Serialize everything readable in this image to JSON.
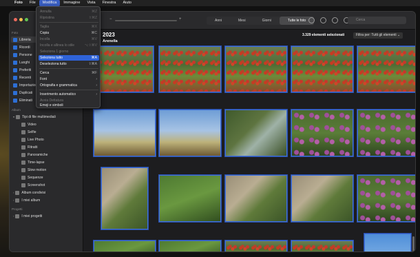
{
  "menubar": {
    "apple": "",
    "items": [
      "Foto",
      "File",
      "Modifica",
      "Immagine",
      "Vista",
      "Finestra",
      "Aiuto"
    ]
  },
  "sidebar": {
    "section_foto": "Foto",
    "items": [
      "Libreria",
      "Ricordi",
      "Persone",
      "Luoghi",
      "Preferiti",
      "Recenti",
      "Importazioni",
      "Duplicati",
      "Eliminati"
    ],
    "section_album": "Album",
    "media_types_label": "Tipi di file multimediali",
    "media_types": [
      "Video",
      "Selfie",
      "Live Photo",
      "Ritratti",
      "Panoramiche",
      "Time-lapse",
      "Slow motion",
      "Sequenze",
      "Screenshot"
    ],
    "shared_albums": "Album condivisi",
    "my_albums": "I miei album",
    "section_projects": "Progetti",
    "my_projects": "I miei progetti"
  },
  "toolbar": {
    "zoom_min": "−",
    "zoom_plus": "+",
    "views": [
      "Anni",
      "Mesi",
      "Giorni",
      "Tutte le foto"
    ],
    "active_view": "Tutte le foto",
    "search_placeholder": "Cerca"
  },
  "content": {
    "year": "2023",
    "location": "Arenella",
    "selection_count": "3.329 elementi selezionati",
    "filter": "Filtra per: Tutti gli elementi ⌄"
  },
  "edit_menu": {
    "items": [
      {
        "label": "Annulla",
        "shortcut": "⌘Z",
        "enabled": false
      },
      {
        "label": "Ripristina",
        "shortcut": "⇧⌘Z",
        "enabled": false
      },
      {
        "label": "Taglia",
        "shortcut": "⌘X",
        "enabled": false
      },
      {
        "label": "Copia",
        "shortcut": "⌘C",
        "enabled": true
      },
      {
        "label": "Incolla",
        "shortcut": "⌘V",
        "enabled": false
      },
      {
        "label": "Incolla e allinea lo stile",
        "shortcut": "⌥⇧⌘V",
        "enabled": false
      },
      {
        "label": "Seleziona 1 giorno",
        "shortcut": "",
        "enabled": false
      },
      {
        "label": "Seleziona tutto",
        "shortcut": "⌘A",
        "enabled": true,
        "highlighted": true
      },
      {
        "label": "Deseleziona tutto",
        "shortcut": "⇧⌘A",
        "enabled": true
      },
      {
        "label": "Cerca",
        "shortcut": "⌘F",
        "enabled": true
      },
      {
        "label": "Font",
        "shortcut": "›",
        "enabled": true
      },
      {
        "label": "Ortografia e grammatica",
        "shortcut": "›",
        "enabled": true
      },
      {
        "label": "Inserimento automatico",
        "shortcut": "›",
        "enabled": true
      },
      {
        "label": "Avvia Dettatura",
        "shortcut": "",
        "enabled": false
      },
      {
        "label": "Emoji e simboli",
        "shortcut": "",
        "enabled": true
      }
    ]
  }
}
